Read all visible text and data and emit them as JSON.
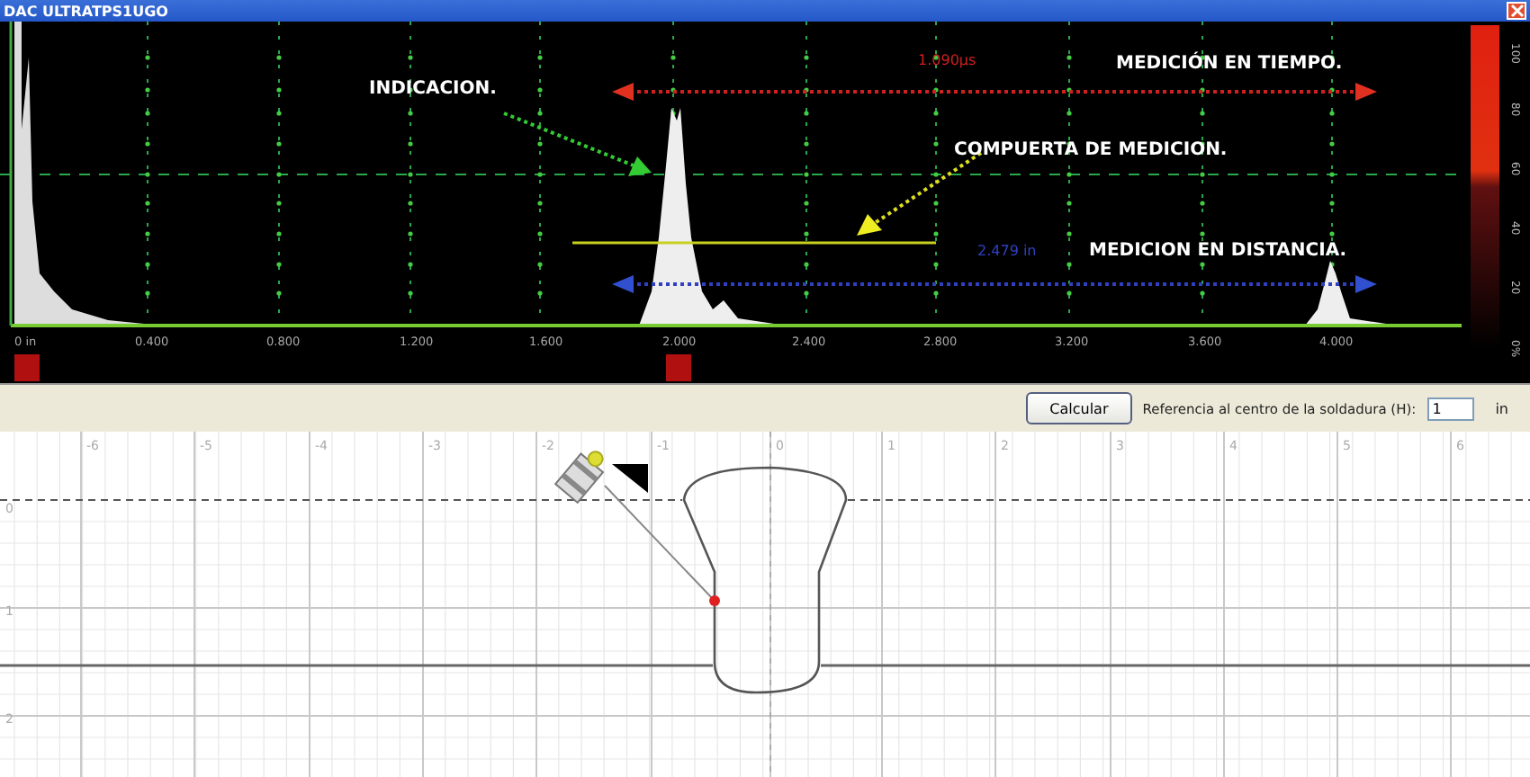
{
  "window": {
    "title": "DAC ULTRATPS1UGO"
  },
  "scope": {
    "x_ticks": [
      "0 in",
      "0.400",
      "0.800",
      "1.200",
      "1.600",
      "2.000",
      "2.400",
      "2.800",
      "3.200",
      "3.600",
      "4.000"
    ],
    "amplitude_ticks": [
      "100",
      "80",
      "60",
      "40",
      "20",
      "0%"
    ],
    "annotations": [
      {
        "kind": "callout",
        "text": "INDICACION."
      },
      {
        "kind": "readout",
        "text": "1.090μs",
        "color": "#d02020"
      },
      {
        "kind": "callout",
        "text": "MEDICIÓN EN TIEMPO."
      },
      {
        "kind": "callout",
        "text": "COMPUERTA DE MEDICION."
      },
      {
        "kind": "readout",
        "text": "2.479 in",
        "color": "#3040c0"
      },
      {
        "kind": "callout",
        "text": "MEDICION EN DISTANCIA."
      }
    ]
  },
  "toolbar": {
    "button": "Calcular",
    "label": "Referencia al centro de la soldadura (H):",
    "value": "1",
    "unit": "in"
  },
  "plan": {
    "x_ticks": [
      "-6",
      "-5",
      "-4",
      "-3",
      "-2",
      "-1",
      "0",
      "1",
      "2",
      "3",
      "4",
      "5",
      "6"
    ],
    "y_ticks": [
      "0",
      "1",
      "2"
    ]
  }
}
